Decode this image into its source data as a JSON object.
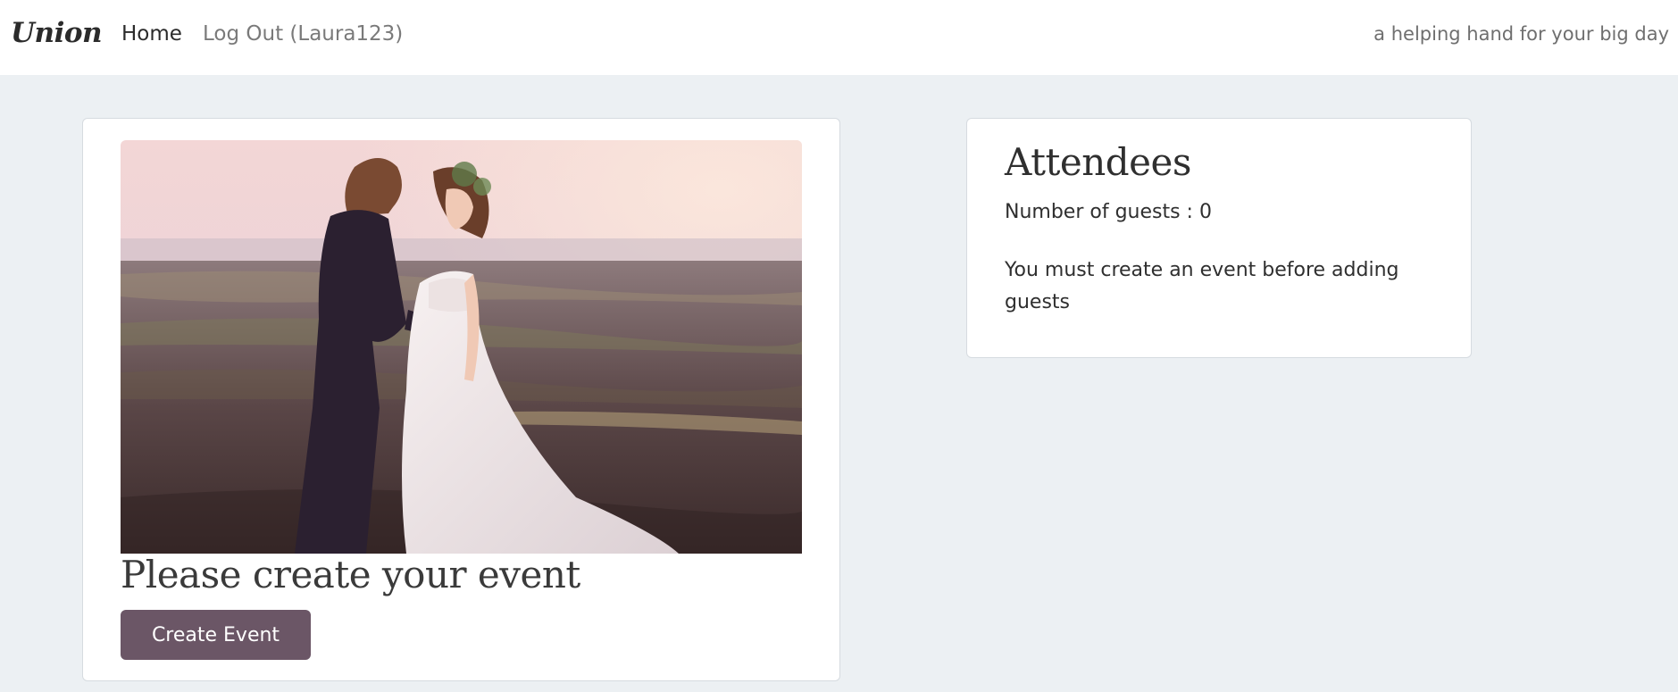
{
  "navbar": {
    "brand": "Union",
    "home_label": "Home",
    "logout_label": "Log Out (Laura123)",
    "tagline": "a helping hand for your big day"
  },
  "event_card": {
    "image": "wedding-couple-photo",
    "heading": "Please create your event",
    "create_button_label": "Create Event"
  },
  "attendees_card": {
    "title": "Attendees",
    "guest_count_text": "Number of guests : 0",
    "notice": "You must create an event before adding guests"
  },
  "colors": {
    "page_background": "#ecf0f3",
    "button_background": "#6b5666",
    "card_background": "#ffffff"
  }
}
